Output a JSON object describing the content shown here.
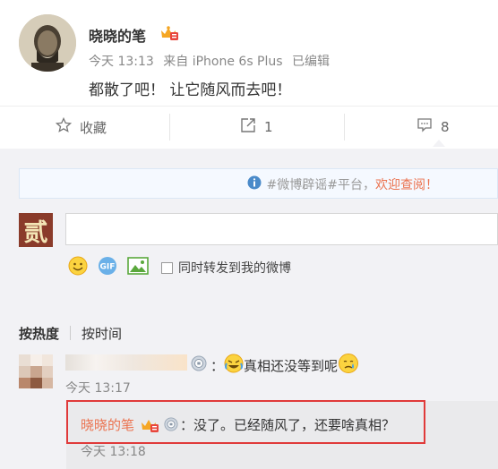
{
  "post": {
    "username": "晓晓的笔",
    "time": "今天 13:13",
    "source": "来自 iPhone 6s Plus",
    "edited": "已编辑",
    "text": "都散了吧！ 让它随风而去吧！"
  },
  "toolbar": {
    "favorite_label": "收藏",
    "forward_count": "1",
    "comment_count": "8"
  },
  "notice": {
    "tag": "#微博辟谣#平台，",
    "link": "欢迎查阅！"
  },
  "composer": {
    "avatar_char": "贰",
    "forward_label": "同时转发到我的微博"
  },
  "sort": {
    "hot": "按热度",
    "time": "按时间"
  },
  "comments": [
    {
      "text": "真相还没等到呢",
      "time": "今天 13:17"
    }
  ],
  "reply": {
    "username": "晓晓的笔",
    "text": "：没了。已经随风了，还要啥真相？",
    "time": "今天 13:18"
  },
  "colors": {
    "accent": "#eb7350",
    "highlight": "#e03a3a",
    "link_blue": "#4a8ac9"
  },
  "icons": [
    "star-icon",
    "forward-icon",
    "comment-icon",
    "info-icon",
    "smiley-icon",
    "gif-icon",
    "image-icon",
    "vip-crown-icon",
    "cry-laugh-emoji",
    "sad-tear-emoji"
  ]
}
